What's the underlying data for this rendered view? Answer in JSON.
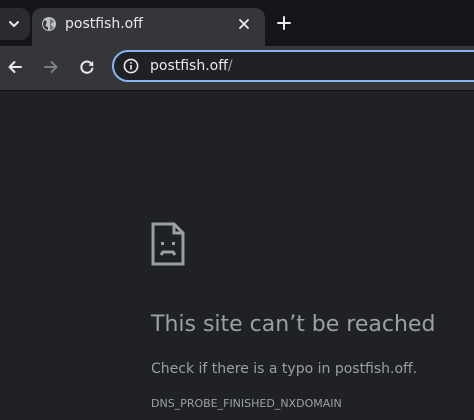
{
  "tab": {
    "title": "postfish.off",
    "favicon": "globe-icon"
  },
  "toolbar": {
    "url_host": "postfish.off",
    "url_path": "/"
  },
  "error": {
    "icon": "sad-page-icon",
    "title": "This site can’t be reached",
    "message": "Check if there is a typo in postfish.off.",
    "code": "DNS_PROBE_FINISHED_NXDOMAIN"
  },
  "colors": {
    "background": "#202124",
    "toolbar": "#35363a",
    "tabstrip": "#141518",
    "focus_ring": "#8ab4f8",
    "text_primary": "#e8eaed",
    "text_secondary": "#9aa0a6"
  }
}
